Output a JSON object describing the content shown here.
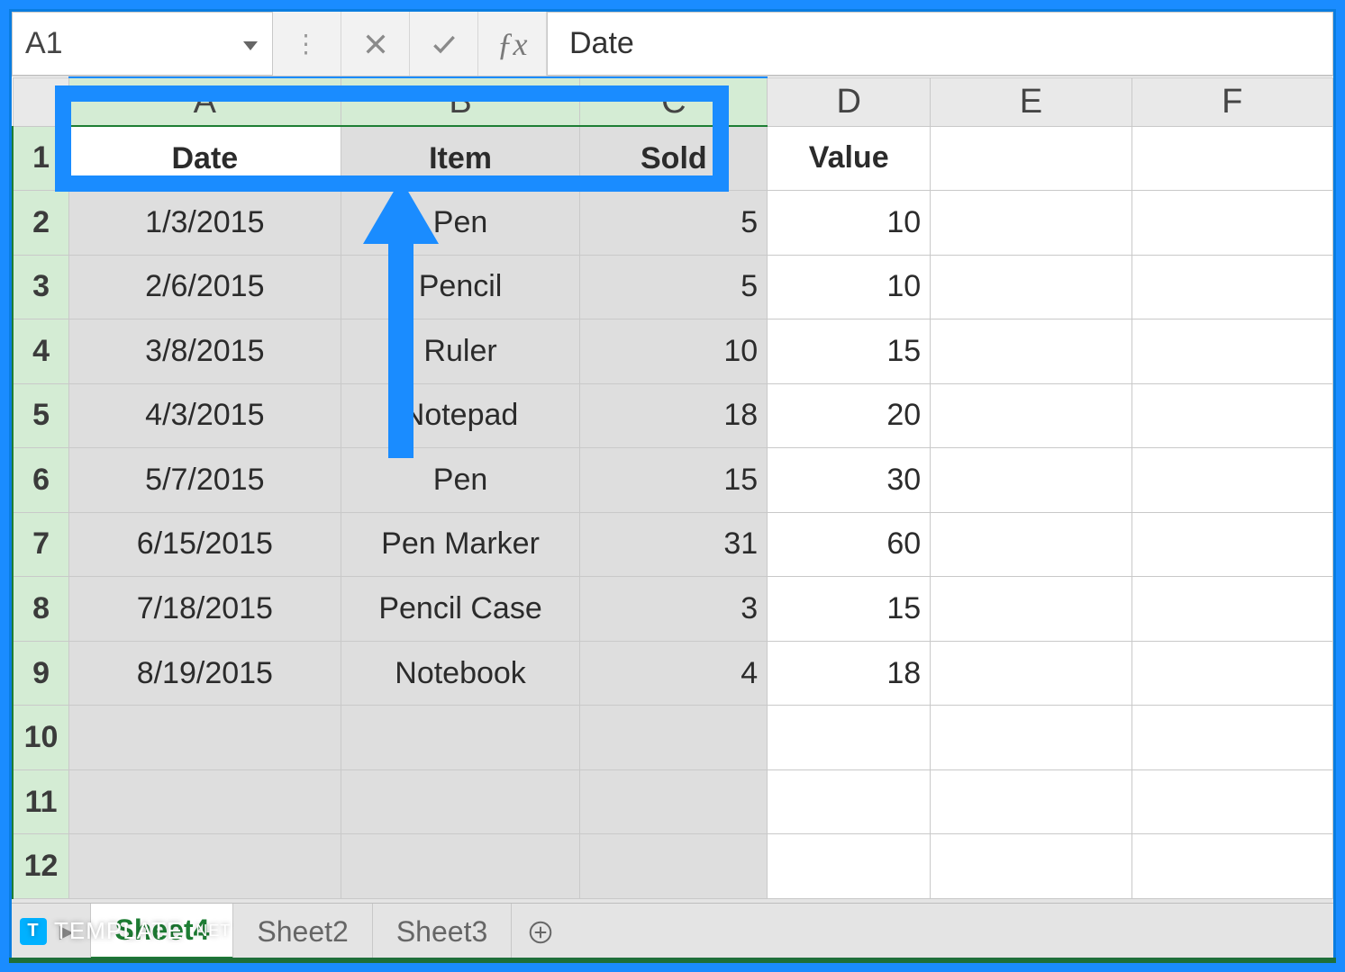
{
  "nameBox": "A1",
  "formulaValue": "Date",
  "columns": [
    "A",
    "B",
    "C",
    "D",
    "E",
    "F"
  ],
  "selectedColumns": [
    "A",
    "B",
    "C"
  ],
  "rowCount": 12,
  "headers": {
    "A": "Date",
    "B": "Item",
    "C": "Sold",
    "D": "Value"
  },
  "chart_data": {
    "type": "table",
    "columns": [
      "Date",
      "Item",
      "Sold",
      "Value"
    ],
    "rows": [
      [
        "1/3/2015",
        "Pen",
        5,
        10
      ],
      [
        "2/6/2015",
        "Pencil",
        5,
        10
      ],
      [
        "3/8/2015",
        "Ruler",
        10,
        15
      ],
      [
        "4/3/2015",
        "Notepad",
        18,
        20
      ],
      [
        "5/7/2015",
        "Pen",
        15,
        30
      ],
      [
        "6/15/2015",
        "Pen Marker",
        31,
        60
      ],
      [
        "7/18/2015",
        "Pencil Case",
        3,
        15
      ],
      [
        "8/19/2015",
        "Notebook",
        4,
        18
      ]
    ]
  },
  "tabs": [
    {
      "label": "Sheet4",
      "active": true
    },
    {
      "label": "Sheet2",
      "active": false
    },
    {
      "label": "Sheet3",
      "active": false
    }
  ],
  "watermark": {
    "brand": "TEMPLATE",
    "suffix": ".NET",
    "badge": "T"
  }
}
